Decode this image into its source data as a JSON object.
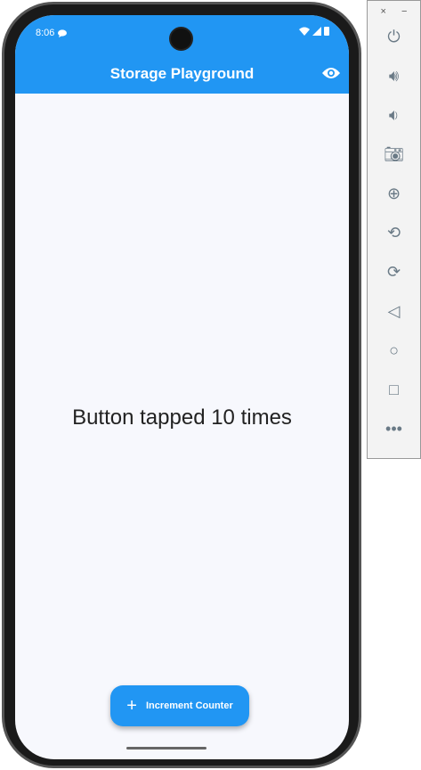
{
  "status": {
    "time": "8:06"
  },
  "appbar": {
    "title": "Storage Playground"
  },
  "main": {
    "counter_text": "Button tapped 10 times"
  },
  "fab": {
    "icon": "+",
    "label": "Increment Counter"
  },
  "emulator_panel": {
    "close": "×",
    "minimize": "−"
  },
  "colors": {
    "primary": "#2196F3",
    "background": "#F7F8FD"
  }
}
